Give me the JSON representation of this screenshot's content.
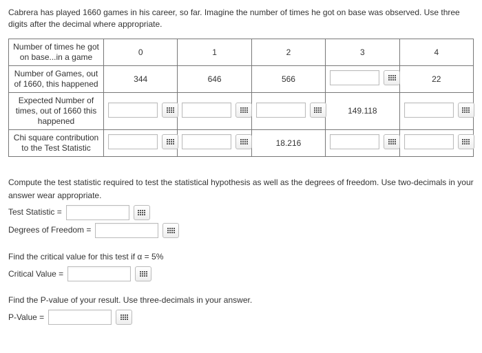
{
  "intro": "Cabrera has played 1660 games in his career, so far. Imagine the number of times he got on base was observed. Use three digits after the decimal where appropriate.",
  "table": {
    "row_headers": [
      "Number of times he got on base...in a game",
      "Number of Games, out of 1660, this happened",
      "Expected Number of times, out of 1660 this happened",
      "Chi square contribution to the Test Statistic"
    ],
    "cols": [
      "0",
      "1",
      "2",
      "3",
      "4"
    ],
    "observed": [
      "344",
      "646",
      "566",
      "",
      "22"
    ],
    "expected": [
      "",
      "",
      "",
      "149.118",
      ""
    ],
    "chi": [
      "",
      "",
      "18.216",
      "",
      ""
    ]
  },
  "section1": {
    "text": "Compute the test statistic required to test the statistical hypothesis as well as the degrees of freedom. Use two-decimals in your answer wear appropriate.",
    "test_stat_label": "Test Statistic =",
    "dof_label": "Degrees of Freedom ="
  },
  "section2": {
    "text": "Find the critical value for this test if α = 5%",
    "crit_label": "Critical Value ="
  },
  "section3": {
    "text": "Find the P-value of your result. Use three-decimals in your answer.",
    "pval_label": "P-Value ="
  }
}
